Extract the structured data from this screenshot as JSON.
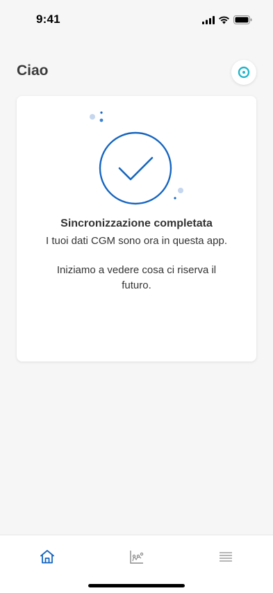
{
  "status_bar": {
    "time": "9:41",
    "icons": [
      "signal-icon",
      "wifi-icon",
      "battery-icon"
    ]
  },
  "header": {
    "greeting": "Ciao",
    "sensor_icon": "sensor-icon"
  },
  "card": {
    "icon": "check-circle-icon",
    "title": "Sincronizzazione completata",
    "subtitle": "I tuoi dati CGM sono ora in questa app.",
    "body": "Iniziamo a vedere cosa ci riserva il futuro."
  },
  "tab_bar": {
    "tabs": [
      {
        "icon": "home-icon",
        "active": true
      },
      {
        "icon": "chart-icon",
        "active": false
      },
      {
        "icon": "menu-icon",
        "active": false
      }
    ]
  },
  "colors": {
    "accent": "#1565c0",
    "sensor_ring": "#22b5c9",
    "background": "#f6f6f6",
    "inactive_icon": "#8a8a8a"
  }
}
